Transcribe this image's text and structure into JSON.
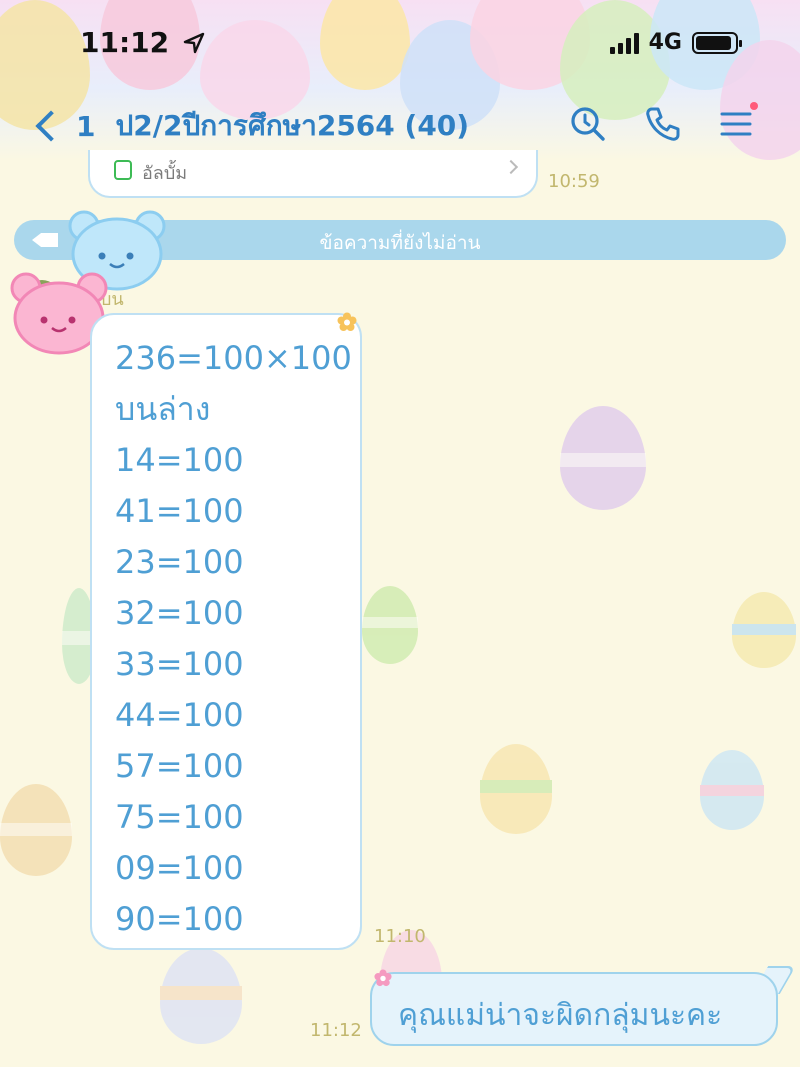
{
  "status_bar": {
    "time": "11:12",
    "network": "4G"
  },
  "header": {
    "back_count": "1",
    "chat_title": "ป2/2ปีการศึกษา2564 (40)"
  },
  "icons": {
    "back": "chevron-left-icon",
    "search": "search-icon",
    "call": "phone-icon",
    "menu": "menu-icon",
    "location": "location-arrow-icon"
  },
  "colors": {
    "accent": "#2f7fc3",
    "bubble_text": "#4f9fd4",
    "divider": "#aad7ec",
    "timestamp": "#c2b76e"
  },
  "previous_message": {
    "label": "อัลบั้ม",
    "time": "10:59"
  },
  "unread_divider": {
    "text": "ข้อความที่ยังไม่อ่าน"
  },
  "incoming_message": {
    "sender_partial": "บน",
    "lines": [
      "236=100×100",
      "บนล่าง",
      "14=100",
      "41=100",
      "23=100",
      "32=100",
      "33=100",
      "44=100",
      "57=100",
      "75=100",
      "09=100",
      "90=100"
    ],
    "time": "11:10"
  },
  "outgoing_message": {
    "text": "คุณแม่น่าจะผิดกลุ่มนะคะ",
    "time": "11:12"
  }
}
